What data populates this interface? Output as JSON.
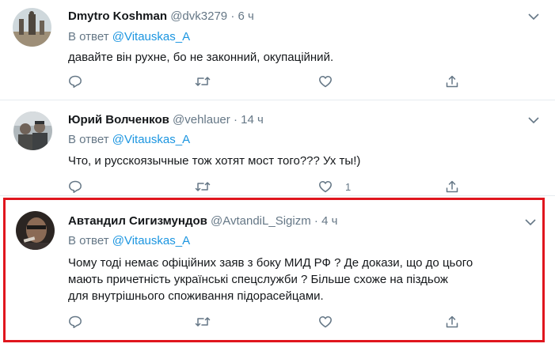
{
  "reply_prefix": "В ответ",
  "tweets": [
    {
      "name": "Dmytro Koshman",
      "handle": "@dvk3279",
      "dot": "·",
      "time": "6 ч",
      "reply_to": "@Vitauskas_A",
      "text_lines": [
        "давайте він рухне, бо не законний, окупаційний."
      ],
      "like_count": ""
    },
    {
      "name": "Юрий Волченков",
      "handle": "@vehlauer",
      "dot": "·",
      "time": "14 ч",
      "reply_to": "@Vitauskas_A",
      "text_lines": [
        "Что, и русскоязычные тож хотят мост того??? Ух ты!)"
      ],
      "like_count": "1"
    },
    {
      "name": "Автандил Сигизмундов",
      "handle": "@AvtandiL_Sigizm",
      "dot": "·",
      "time": "4 ч",
      "reply_to": "@Vitauskas_A",
      "text_lines": [
        "Чому тоді немає офіційних заяв з боку МИД РФ ? Де докази, що до цього",
        "мають причетність українські спецслужби ?  Більше схоже на піздьож",
        "для внутрішнього споживання підорасейцами."
      ],
      "like_count": ""
    }
  ],
  "colors": {
    "accent": "#1b95e0",
    "secondary_text": "#657786",
    "highlight_border": "#e0161e",
    "divider": "#e6ecf0"
  },
  "icons": [
    "reply-icon",
    "retweet-icon",
    "like-icon",
    "share-icon",
    "chevron-down-icon"
  ]
}
